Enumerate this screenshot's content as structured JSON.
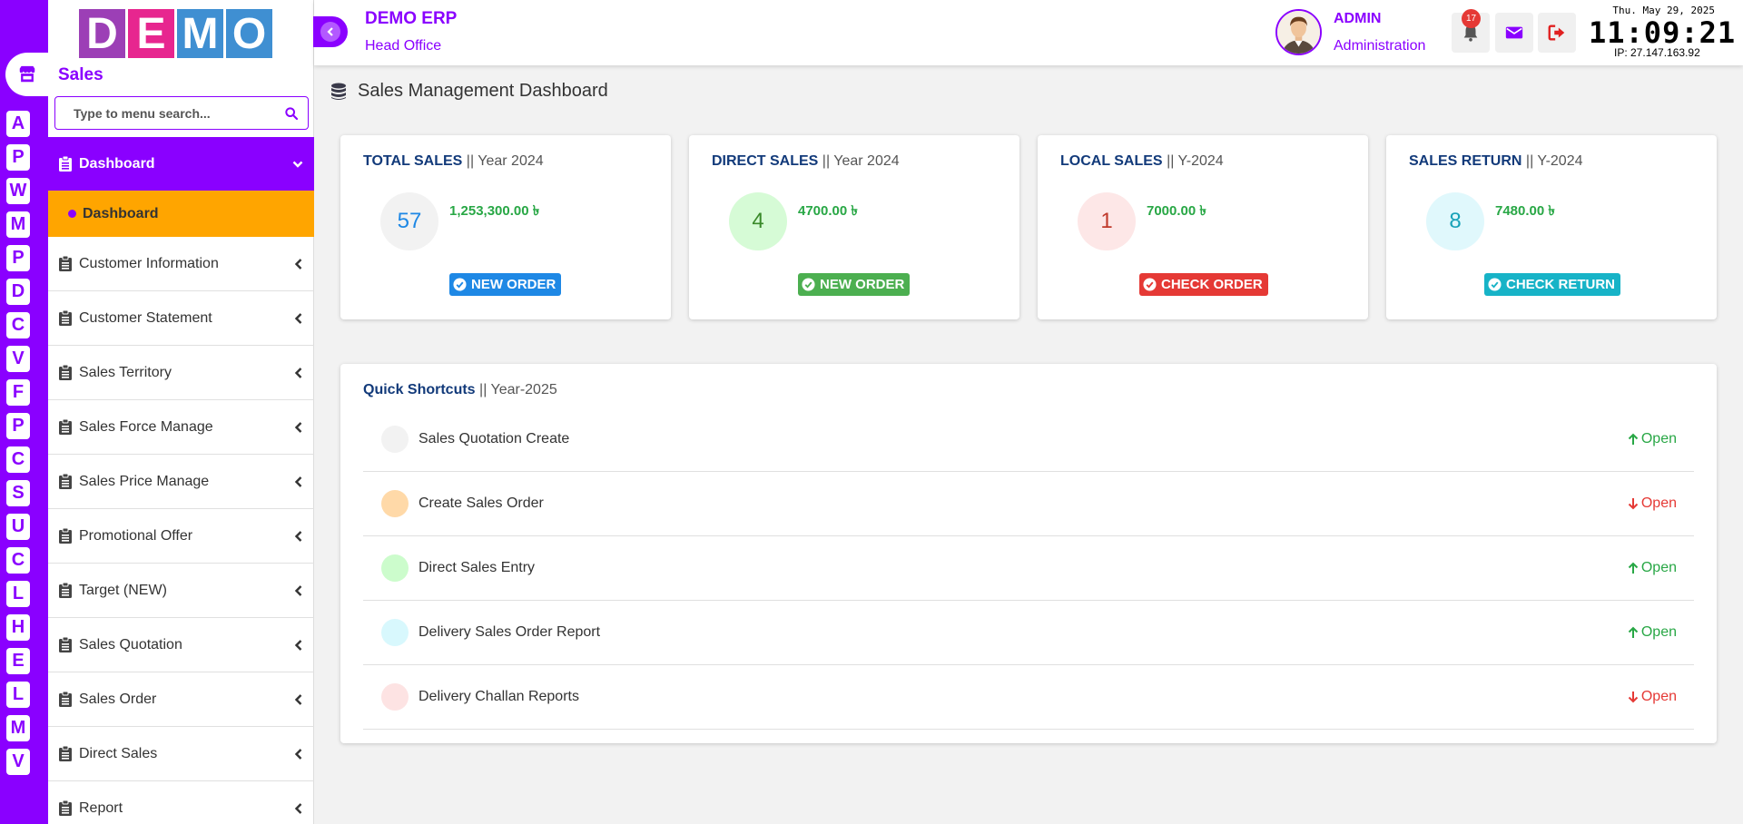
{
  "colors": {
    "brand": "#8a00ff",
    "submenu_active": "#ffa500",
    "success": "#28a745",
    "danger": "#e53935",
    "primary": "#1e88e5",
    "info": "#17b3c7",
    "heading_blue": "#123a7a"
  },
  "rail": {
    "home_icon": "store-icon",
    "letters": [
      "A",
      "P",
      "W",
      "M",
      "P",
      "D",
      "C",
      "V",
      "F",
      "P",
      "C",
      "S",
      "U",
      "C",
      "L",
      "H",
      "E",
      "L",
      "M",
      "V"
    ]
  },
  "logo": {
    "letters": [
      {
        "char": "D",
        "color": "#9c3fb6"
      },
      {
        "char": "E",
        "color": "#e7268f"
      },
      {
        "char": "M",
        "color": "#3f8fd2"
      },
      {
        "char": "O",
        "color": "#3f8fd2"
      }
    ]
  },
  "sidebar": {
    "module_title": "Sales",
    "search_placeholder": "Type to menu search...",
    "active_item": {
      "label": "Dashboard",
      "icon": "clipboard-icon"
    },
    "active_subitem": {
      "label": "Dashboard"
    },
    "items": [
      {
        "label": "Customer Information"
      },
      {
        "label": "Customer Statement"
      },
      {
        "label": "Sales Territory"
      },
      {
        "label": "Sales Force Manage"
      },
      {
        "label": "Sales Price Manage"
      },
      {
        "label": "Promotional Offer"
      },
      {
        "label": "Target (NEW)"
      },
      {
        "label": "Sales Quotation"
      },
      {
        "label": "Sales Order"
      },
      {
        "label": "Direct Sales"
      },
      {
        "label": "Report"
      }
    ]
  },
  "header": {
    "app_title": "DEMO ERP",
    "branch": "Head Office",
    "user_name": "ADMIN",
    "user_role": "Administration",
    "notification_count": "17",
    "date": "Thu. May 29, 2025",
    "time": "11:09:21",
    "ip": "IP: 27.147.163.92"
  },
  "page": {
    "title": "Sales Management Dashboard",
    "title_icon": "database-icon"
  },
  "cards": [
    {
      "title": "TOTAL SALES",
      "period": "|| Year 2024",
      "count": "57",
      "amount": "1,253,300.00 ৳",
      "button": "NEW ORDER",
      "circle_bg": "#f2f2f2",
      "circle_fg": "#1e88e5",
      "button_color": "#1e88e5"
    },
    {
      "title": "DIRECT SALES",
      "period": "|| Year 2024",
      "count": "4",
      "amount": "4700.00 ৳",
      "button": "NEW ORDER",
      "circle_bg": "#d6fbd6",
      "circle_fg": "#3a8a2a",
      "button_color": "#4caf50"
    },
    {
      "title": "LOCAL SALES",
      "period": "|| Y-2024",
      "count": "1",
      "amount": "7000.00 ৳",
      "button": "CHECK ORDER",
      "circle_bg": "#fde7e7",
      "circle_fg": "#c0392b",
      "button_color": "#e53935"
    },
    {
      "title": "SALES RETURN",
      "period": "|| Y-2024",
      "count": "8",
      "amount": "7480.00 ৳",
      "button": "CHECK RETURN",
      "circle_bg": "#e0f8fc",
      "circle_fg": "#17a2b8",
      "button_color": "#17b3c7"
    }
  ],
  "shortcuts": {
    "title": "Quick Shortcuts",
    "period": "|| Year-2025",
    "items": [
      {
        "label": "Sales Quotation Create",
        "action": "Open",
        "direction": "up",
        "dot": "#f2f2f2"
      },
      {
        "label": "Create Sales Order",
        "action": "Open",
        "direction": "down",
        "dot": "#ffd9a8"
      },
      {
        "label": "Direct Sales Entry",
        "action": "Open",
        "direction": "up",
        "dot": "#ccfccc"
      },
      {
        "label": "Delivery Sales Order Report",
        "action": "Open",
        "direction": "up",
        "dot": "#d8f8fd"
      },
      {
        "label": "Delivery Challan Reports",
        "action": "Open",
        "direction": "down",
        "dot": "#fde3e3"
      }
    ]
  }
}
